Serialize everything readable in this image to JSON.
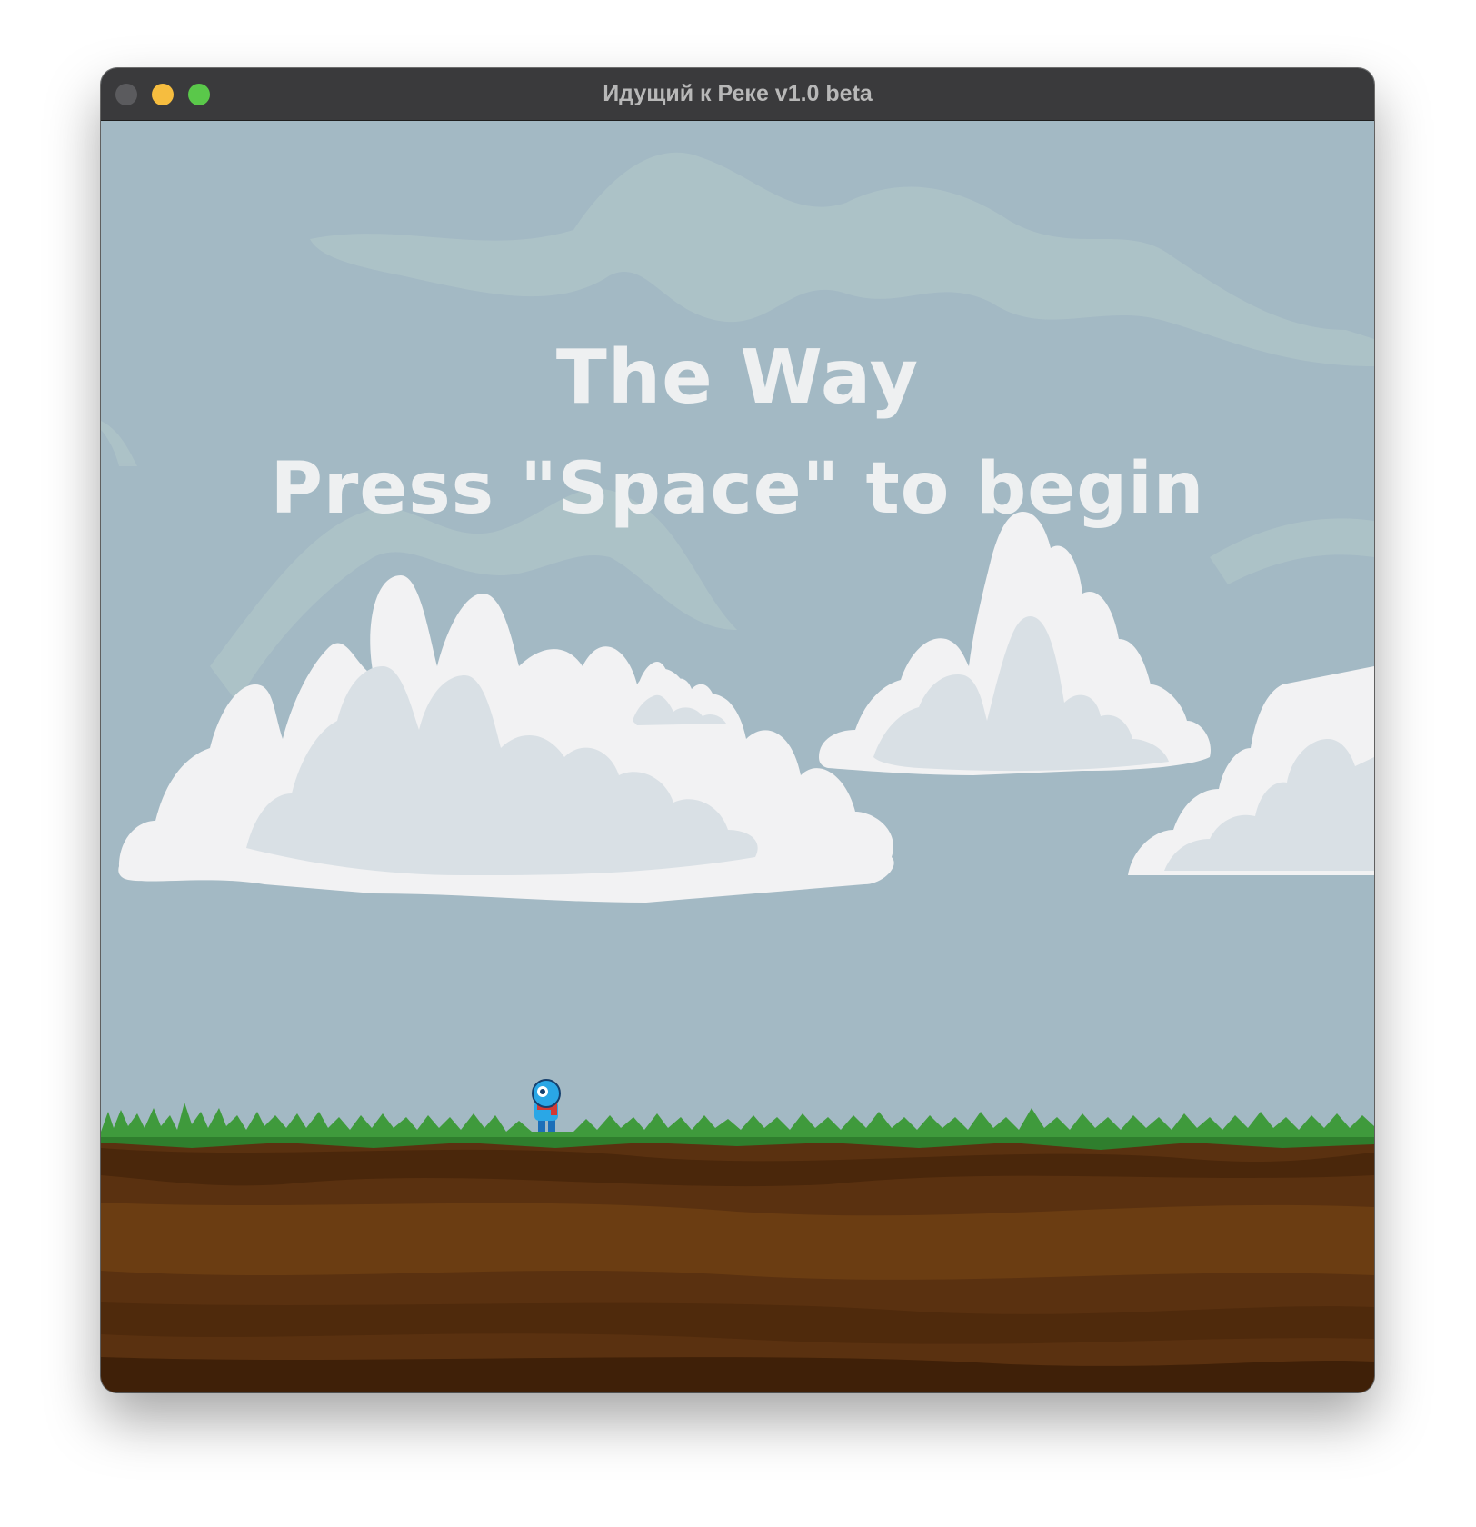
{
  "window": {
    "title": "Идущий к Реке v1.0 beta",
    "controls": {
      "close_color": "#5b5b5e",
      "minimize_color": "#f6bd3f",
      "maximize_color": "#5ac84a"
    }
  },
  "game": {
    "title": "The Way",
    "prompt": "Press \"Space\" to begin",
    "colors": {
      "sky": "#a3b9c4",
      "cloud_light": "#f2f2f3",
      "cloud_shade": "#d9e0e5",
      "grass": "#3f9a3c",
      "soil": "#5a3110",
      "character_body": "#2aa7e6",
      "character_scarf": "#d23a34"
    },
    "character": {
      "name": "player-character"
    }
  }
}
